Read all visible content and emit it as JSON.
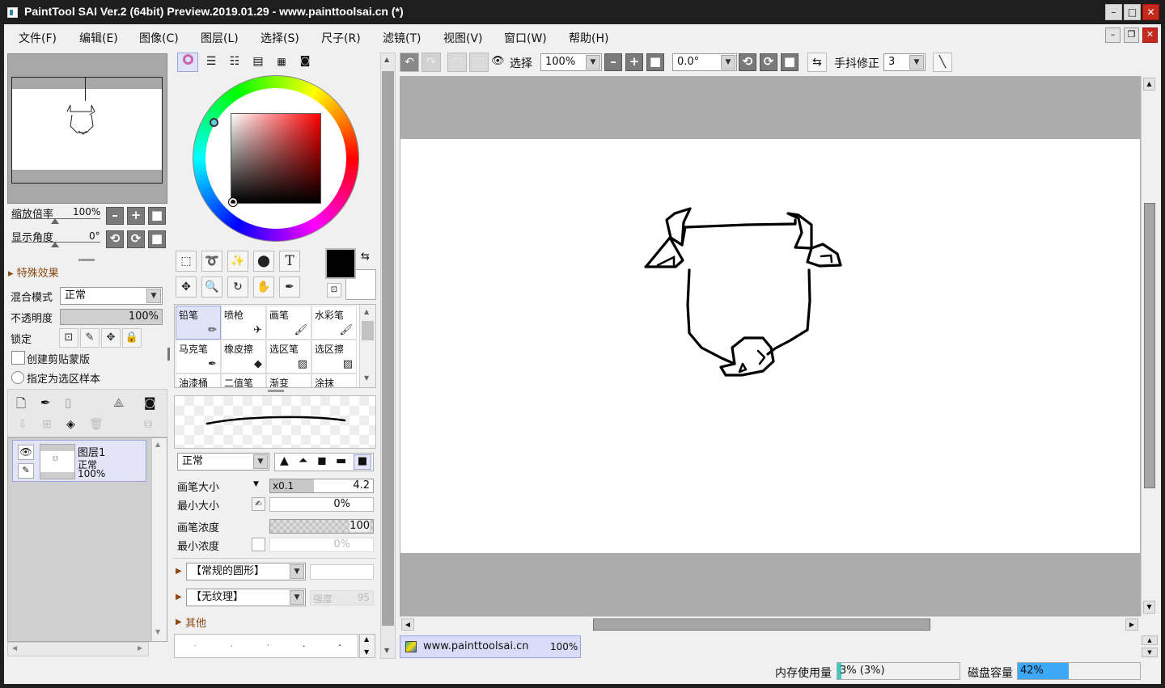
{
  "window": {
    "title": "PaintTool SAI Ver.2 (64bit) Preview.2019.01.29 - www.painttoolsai.cn (*)"
  },
  "menu": [
    "文件(F)",
    "编辑(E)",
    "图像(C)",
    "图层(L)",
    "选择(S)",
    "尺子(R)",
    "滤镜(T)",
    "视图(V)",
    "窗口(W)",
    "帮助(H)"
  ],
  "navigator": {
    "zoom_label": "缩放倍率",
    "zoom_value": "100%",
    "angle_label": "显示角度",
    "angle_value": "0°"
  },
  "layer_props": {
    "effects_label": "特殊效果",
    "blend_label": "混合模式",
    "blend_value": "正常",
    "opacity_label": "不透明度",
    "opacity_value": "100%",
    "lock_label": "锁定",
    "clip_label": "创建剪贴蒙版",
    "sample_label": "指定为选区样本"
  },
  "layers": [
    {
      "name": "图层1",
      "mode": "正常",
      "opacity": "100%"
    }
  ],
  "tools": [
    "铅笔",
    "喷枪",
    "画笔",
    "水彩笔",
    "马克笔",
    "橡皮擦",
    "选区笔",
    "选区擦",
    "油漆桶",
    "二值笔",
    "渐变",
    "涂抹"
  ],
  "brush": {
    "mode_value": "正常",
    "size_label": "画笔大小",
    "size_multiplier": "x0.1",
    "size_value": "4.2",
    "min_size_label": "最小大小",
    "min_size_value": "0%",
    "density_label": "画笔浓度",
    "density_value": "100",
    "min_density_label": "最小浓度",
    "min_density_value": "0%",
    "shape_value": "【常规的圆形】",
    "texture_value": "【无纹理】",
    "strength_label": "强度",
    "strength_value": "95",
    "other_label": "其他"
  },
  "canvas_toolbar": {
    "select_label": "选择",
    "zoom_value": "100%",
    "angle_value": "0.0°",
    "stabilizer_label": "手抖修正",
    "stabilizer_value": "3"
  },
  "canvas_tab": {
    "name": "www.painttoolsai.cn",
    "zoom": "100%"
  },
  "status": {
    "memory_label": "内存使用量",
    "memory_value": "3% (3%)",
    "memory_fraction": 0.03,
    "disk_label": "磁盘容量",
    "disk_value": "42%",
    "disk_fraction": 0.42
  },
  "colors": {
    "primary": "#000000",
    "secondary": "#ffffff",
    "accent": "#3da8f5",
    "memory_bar": "#3cc9c0"
  }
}
